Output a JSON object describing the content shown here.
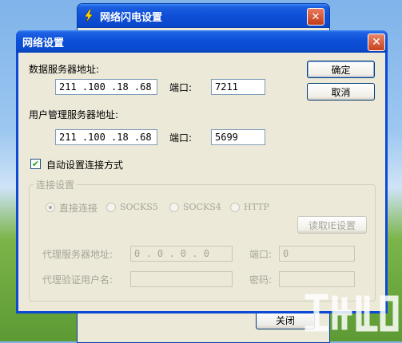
{
  "background_window": {
    "title": "网络闪电设置",
    "close_label": "关闭"
  },
  "dialog": {
    "title": "网络设置",
    "data_server": {
      "label": "数据服务器地址:",
      "ip": "211 .100 .18  .68",
      "port_label": "端口:",
      "port": "7211"
    },
    "user_server": {
      "label": "用户管理服务器地址:",
      "ip": "211 .100 .18  .68",
      "port_label": "端口:",
      "port": "5699"
    },
    "ok_label": "确定",
    "cancel_label": "取消",
    "auto_config": {
      "label": "自动设置连接方式",
      "checked": true
    },
    "connection": {
      "group_label": "连接设置",
      "options": [
        {
          "label": "直接连接",
          "selected": true
        },
        {
          "label": "SOCKS5",
          "selected": false
        },
        {
          "label": "SOCKS4",
          "selected": false
        },
        {
          "label": "HTTP",
          "selected": false
        }
      ],
      "read_ie_label": "读取IE设置",
      "proxy_server_label": "代理服务器地址:",
      "proxy_ip": " 0  .  0  .  0  .  0",
      "proxy_port_label": "端口:",
      "proxy_port": "0",
      "proxy_user_label": "代理验证用户名:",
      "proxy_user": "",
      "password_label": "密码:",
      "password": ""
    }
  }
}
